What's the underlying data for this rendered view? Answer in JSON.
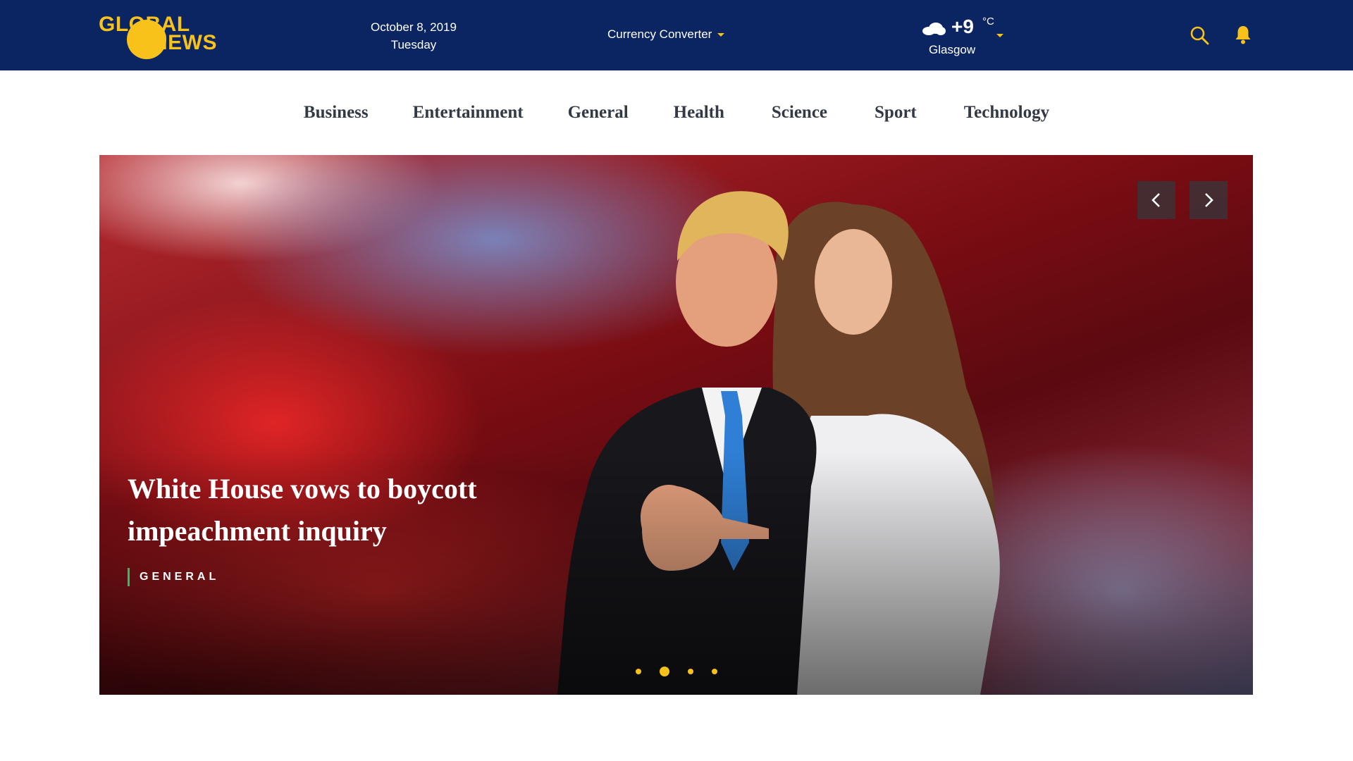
{
  "header": {
    "logo": {
      "line1": "GLOBAL",
      "line2": "NEWS"
    },
    "date": {
      "date": "October 8, 2019",
      "weekday": "Tuesday"
    },
    "currency_converter": "Currency Converter",
    "weather": {
      "icon": "cloud-icon",
      "temperature": "+9",
      "unit": "°C",
      "city": "Glasgow"
    },
    "icons": [
      "search-icon",
      "bell-icon"
    ]
  },
  "categories": [
    "Business",
    "Entertainment",
    "General",
    "Health",
    "Science",
    "Sport",
    "Technology"
  ],
  "hero": {
    "headline_line1": "White House vows to boycott",
    "headline_line2": "impeachment inquiry",
    "category": "GENERAL",
    "slides_total": 4,
    "active_slide": 2
  },
  "colors": {
    "topbar": "#0a2561",
    "accent_yellow": "#f8c21a",
    "category_green": "#27c16a",
    "nav_text": "#333a44"
  }
}
